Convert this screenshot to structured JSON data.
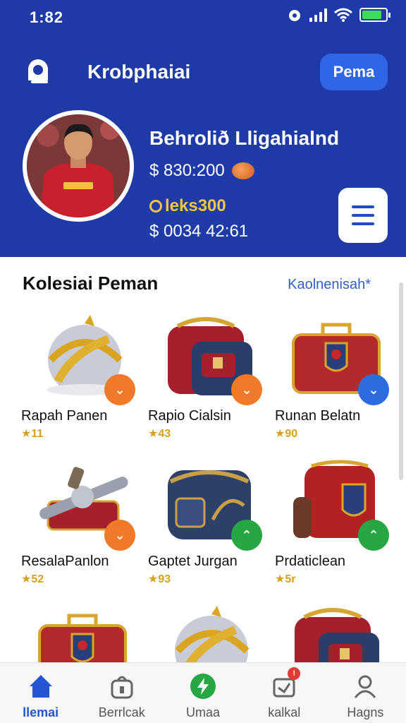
{
  "status_bar": {
    "time": "1:82"
  },
  "header": {
    "app_title": "Krobphaiai",
    "action_label": "Pema"
  },
  "profile": {
    "name": "Behrolið Lligahialnd",
    "balance": "$ 830:200",
    "points": "leks300",
    "secondary_balance": "$ 0034 42:61"
  },
  "collection": {
    "title": "Kolesiai Peman",
    "link": "Kaolnenisah*",
    "items": [
      {
        "name": "Rapah Panen",
        "price": "★11",
        "type": "helmet",
        "badge": "orange"
      },
      {
        "name": "Rapio Cialsin",
        "price": "★43",
        "type": "backpack",
        "badge": "orange"
      },
      {
        "name": "Runan Belatn",
        "price": "★90",
        "type": "suitcase",
        "badge": "blue"
      },
      {
        "name": "ResalaPanlon",
        "price": "★52",
        "type": "cannon",
        "badge": "orange"
      },
      {
        "name": "Gaptet Jurgan",
        "price": "★93",
        "type": "bag",
        "badge": "green"
      },
      {
        "name": "Prdaticlean",
        "price": "★5r",
        "type": "pack",
        "badge": "green"
      },
      {
        "name": "",
        "price": "",
        "type": "suitcase",
        "badge": ""
      },
      {
        "name": "",
        "price": "",
        "type": "helmet",
        "badge": ""
      },
      {
        "name": "",
        "price": "",
        "type": "backpack",
        "badge": ""
      }
    ]
  },
  "nav": [
    {
      "label": "llemai",
      "icon": "home-icon",
      "active": true
    },
    {
      "label": "Berrlcak",
      "icon": "bag-icon",
      "active": false
    },
    {
      "label": "Umaa",
      "icon": "bolt-icon",
      "active": false
    },
    {
      "label": "kalkal",
      "icon": "inbox-icon",
      "active": false,
      "badge": "!"
    },
    {
      "label": "Hagns",
      "icon": "user-icon",
      "active": false
    }
  ],
  "colors": {
    "header_bg": "#1e3aa6",
    "accent": "#2f66e8",
    "badge_orange": "#f07a2a",
    "badge_blue": "#2d6be0",
    "badge_green": "#27a744",
    "price_gold": "#d9a11a"
  }
}
